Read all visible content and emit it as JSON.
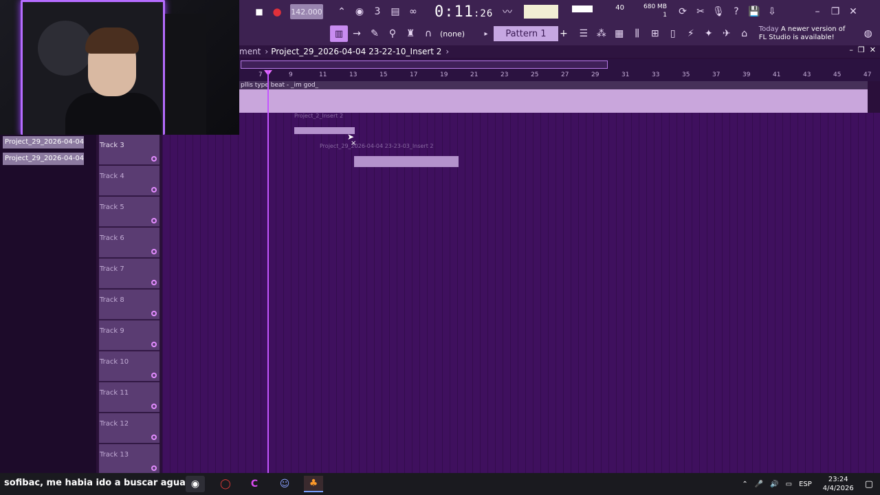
{
  "toolbar": {
    "tempo": "142.000",
    "time_main": "0:11",
    "time_small": ":26",
    "time_unit": "M:S:CS",
    "cpu_value": "40",
    "mem_value": "680 MB",
    "mem_sub": "1",
    "pattern_none": "(none)",
    "pattern_name": "Pattern 1",
    "notice_today": "Today",
    "notice_text": "A newer version of FL Studio is available!"
  },
  "playlist": {
    "crumb": "ment",
    "project": "Project_29_2026-04-04 23-22-10_Insert 2",
    "ruler_ticks": [
      "7",
      "9",
      "11",
      "13",
      "15",
      "17",
      "19",
      "21",
      "23",
      "25",
      "27",
      "29",
      "31",
      "33",
      "35",
      "37",
      "39",
      "41",
      "43",
      "45",
      "47"
    ],
    "big_clip_label": "pllis type beat - _im god_",
    "clip_a_label": "Project_2_Insert 2",
    "clip_b_label": "Project_29_2026-04-04 23-23-03_Insert 2"
  },
  "browser": {
    "items": [
      "Project_29_2026-04-04...",
      "Project_29_2026-04-04..."
    ]
  },
  "tracks": [
    "Track 3",
    "Track 4",
    "Track 5",
    "Track 6",
    "Track 7",
    "Track 8",
    "Track 9",
    "Track 10",
    "Track 11",
    "Track 12",
    "Track 13"
  ],
  "taskbar": {
    "subtitle": "sofibac, me habia ido a buscar agua",
    "lang": "ESP",
    "time": "23:24",
    "date": "4/4/2026"
  },
  "colors": {
    "accent": "#c455ff",
    "grid": "#3f105e",
    "toolbar": "#3d2251"
  }
}
